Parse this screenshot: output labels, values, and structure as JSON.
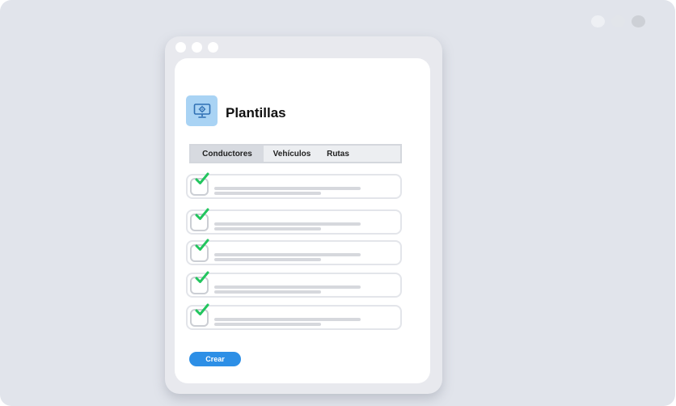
{
  "colors": {
    "backdrop": "#e1e4eb",
    "accent": "#2d8fe6",
    "check": "#22c55e",
    "icon_bg": "#a9d3f4",
    "bg_dots": [
      "#eef0f4",
      "#e2e5ea",
      "#cdd0d6"
    ]
  },
  "header": {
    "title": "Plantillas",
    "icon": "monitor-gear-icon"
  },
  "tabs": [
    {
      "label": "Conductores",
      "active": true
    },
    {
      "label": "Vehículos",
      "active": false
    },
    {
      "label": "Rutas",
      "active": false
    }
  ],
  "items": [
    {
      "checked": true
    },
    {
      "checked": true
    },
    {
      "checked": true
    },
    {
      "checked": true
    },
    {
      "checked": true
    }
  ],
  "actions": {
    "create_label": "Crear"
  }
}
